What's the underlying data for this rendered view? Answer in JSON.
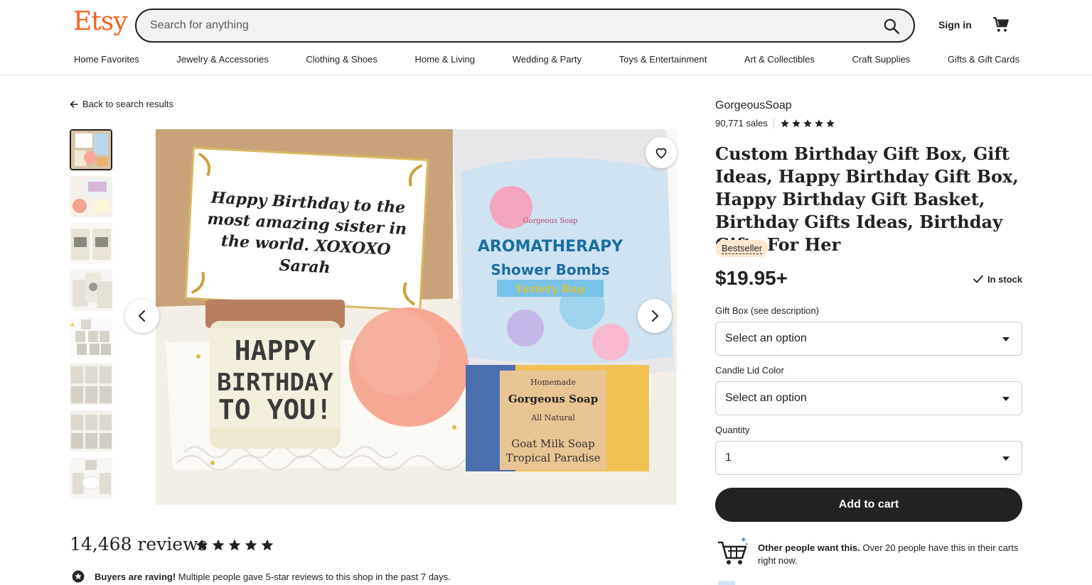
{
  "header": {
    "logo": "Etsy",
    "search_placeholder": "Search for anything",
    "sign_in": "Sign in",
    "nav": [
      "Home Favorites",
      "Jewelry & Accessories",
      "Clothing & Shoes",
      "Home & Living",
      "Wedding & Party",
      "Toys & Entertainment",
      "Art & Collectibles",
      "Craft Supplies",
      "Gifts & Gift Cards"
    ]
  },
  "gallery": {
    "back_label": "Back to search results",
    "thumbnail_count": 8,
    "hero_card_text": [
      "Happy Birthday to the",
      "most amazing sister in",
      "the world. XOXOXO",
      "Sarah"
    ],
    "candle_text": [
      "HAPPY",
      "BIRTHDAY",
      "TO YOU!"
    ],
    "bag_text": [
      "Gorgeous Soap",
      "AROMATHERAPY",
      "Shower Bombs",
      "Variety Bag"
    ],
    "soap_text": [
      "Homemade",
      "Gorgeous Soap",
      "All Natural",
      "Goat Milk Soap",
      "Tropical Paradise"
    ]
  },
  "reviews": {
    "count_label": "14,468 reviews",
    "rating": 5,
    "raving_bold": "Buyers are raving!",
    "raving_text": " Multiple people gave 5-star reviews to this shop in the past 7 days."
  },
  "listing": {
    "shop_name": "GorgeousSoap",
    "sales": "90,771 sales",
    "shop_rating": 5,
    "title": "Custom Birthday Gift Box, Gift Ideas, Happy Birthday Gift Box, Happy Birthday Gift Basket, Birthday Gifts Ideas, Birthday Gifts For Her",
    "badge": "Bestseller",
    "price": "$19.95+",
    "stock": "In stock",
    "options": [
      {
        "label": "Gift Box (see description)",
        "value": "Select an option"
      },
      {
        "label": "Candle Lid Color",
        "value": "Select an option"
      },
      {
        "label": "Quantity",
        "value": "1"
      }
    ],
    "add_to_cart": "Add to cart",
    "demand_bold": "Other people want this.",
    "demand_text": " Over 20 people have this in their carts right now."
  },
  "colors": {
    "brand": "#f1641e",
    "badge_bg": "#fde7cf",
    "button_bg": "#222222"
  }
}
